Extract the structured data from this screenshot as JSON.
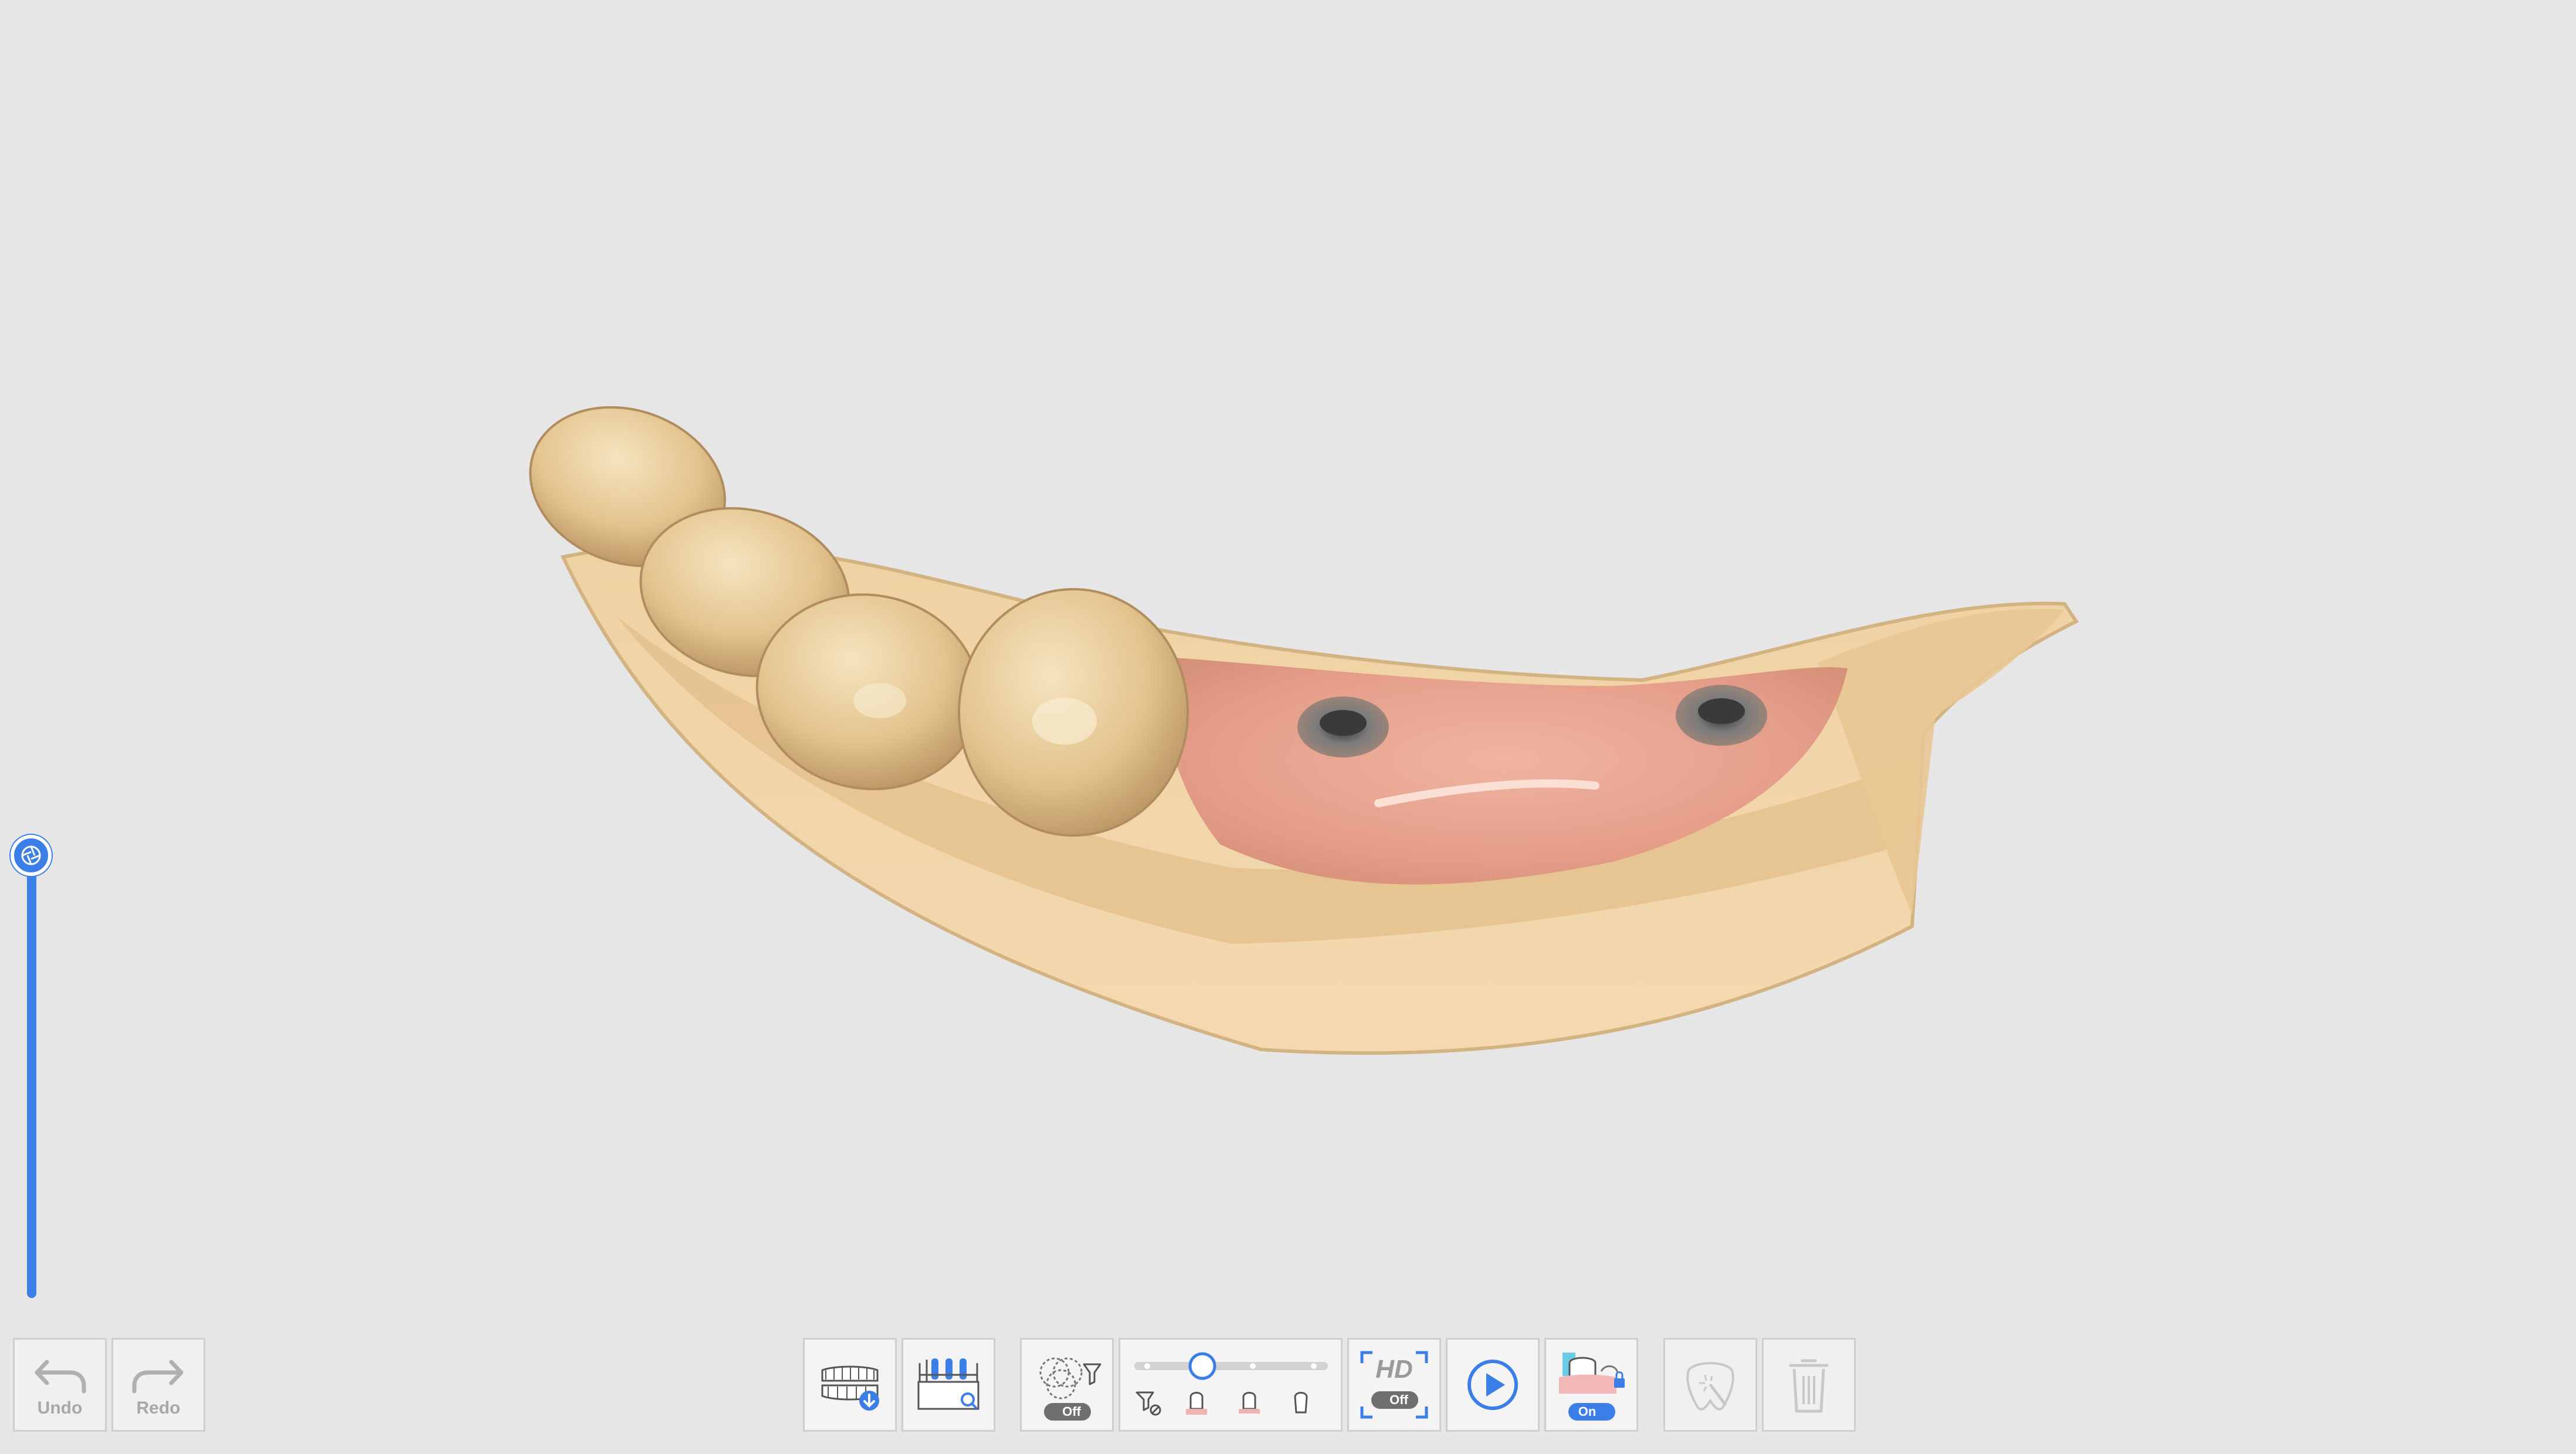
{
  "toolbar": {
    "undo_label": "Undo",
    "redo_label": "Redo",
    "filter_toggle": "Off",
    "hd_label": "HD",
    "hd_toggle": "Off",
    "gingiva_toggle": "On"
  },
  "filter_slider": {
    "value_fraction": 0.35,
    "stops": 4
  },
  "side_slider": {
    "level_fraction": 1.0
  },
  "colors": {
    "accent": "#3b7ee8",
    "background": "#e6e6e6",
    "button_bg": "#f4f4f4",
    "disabled_text": "#a8a8a8",
    "tooth": "#e6c996",
    "gum": "#e7a28f",
    "model_base": "#efcf9f"
  },
  "icons": {
    "undo": "undo-icon",
    "redo": "redo-icon",
    "arch": "dental-arch-import-icon",
    "align": "align-search-icon",
    "filter": "filter-icon",
    "hd": "hd-icon",
    "play": "play-icon",
    "gingiva": "gingiva-lock-icon",
    "auto_trim": "auto-trim-icon",
    "delete": "trash-icon"
  }
}
